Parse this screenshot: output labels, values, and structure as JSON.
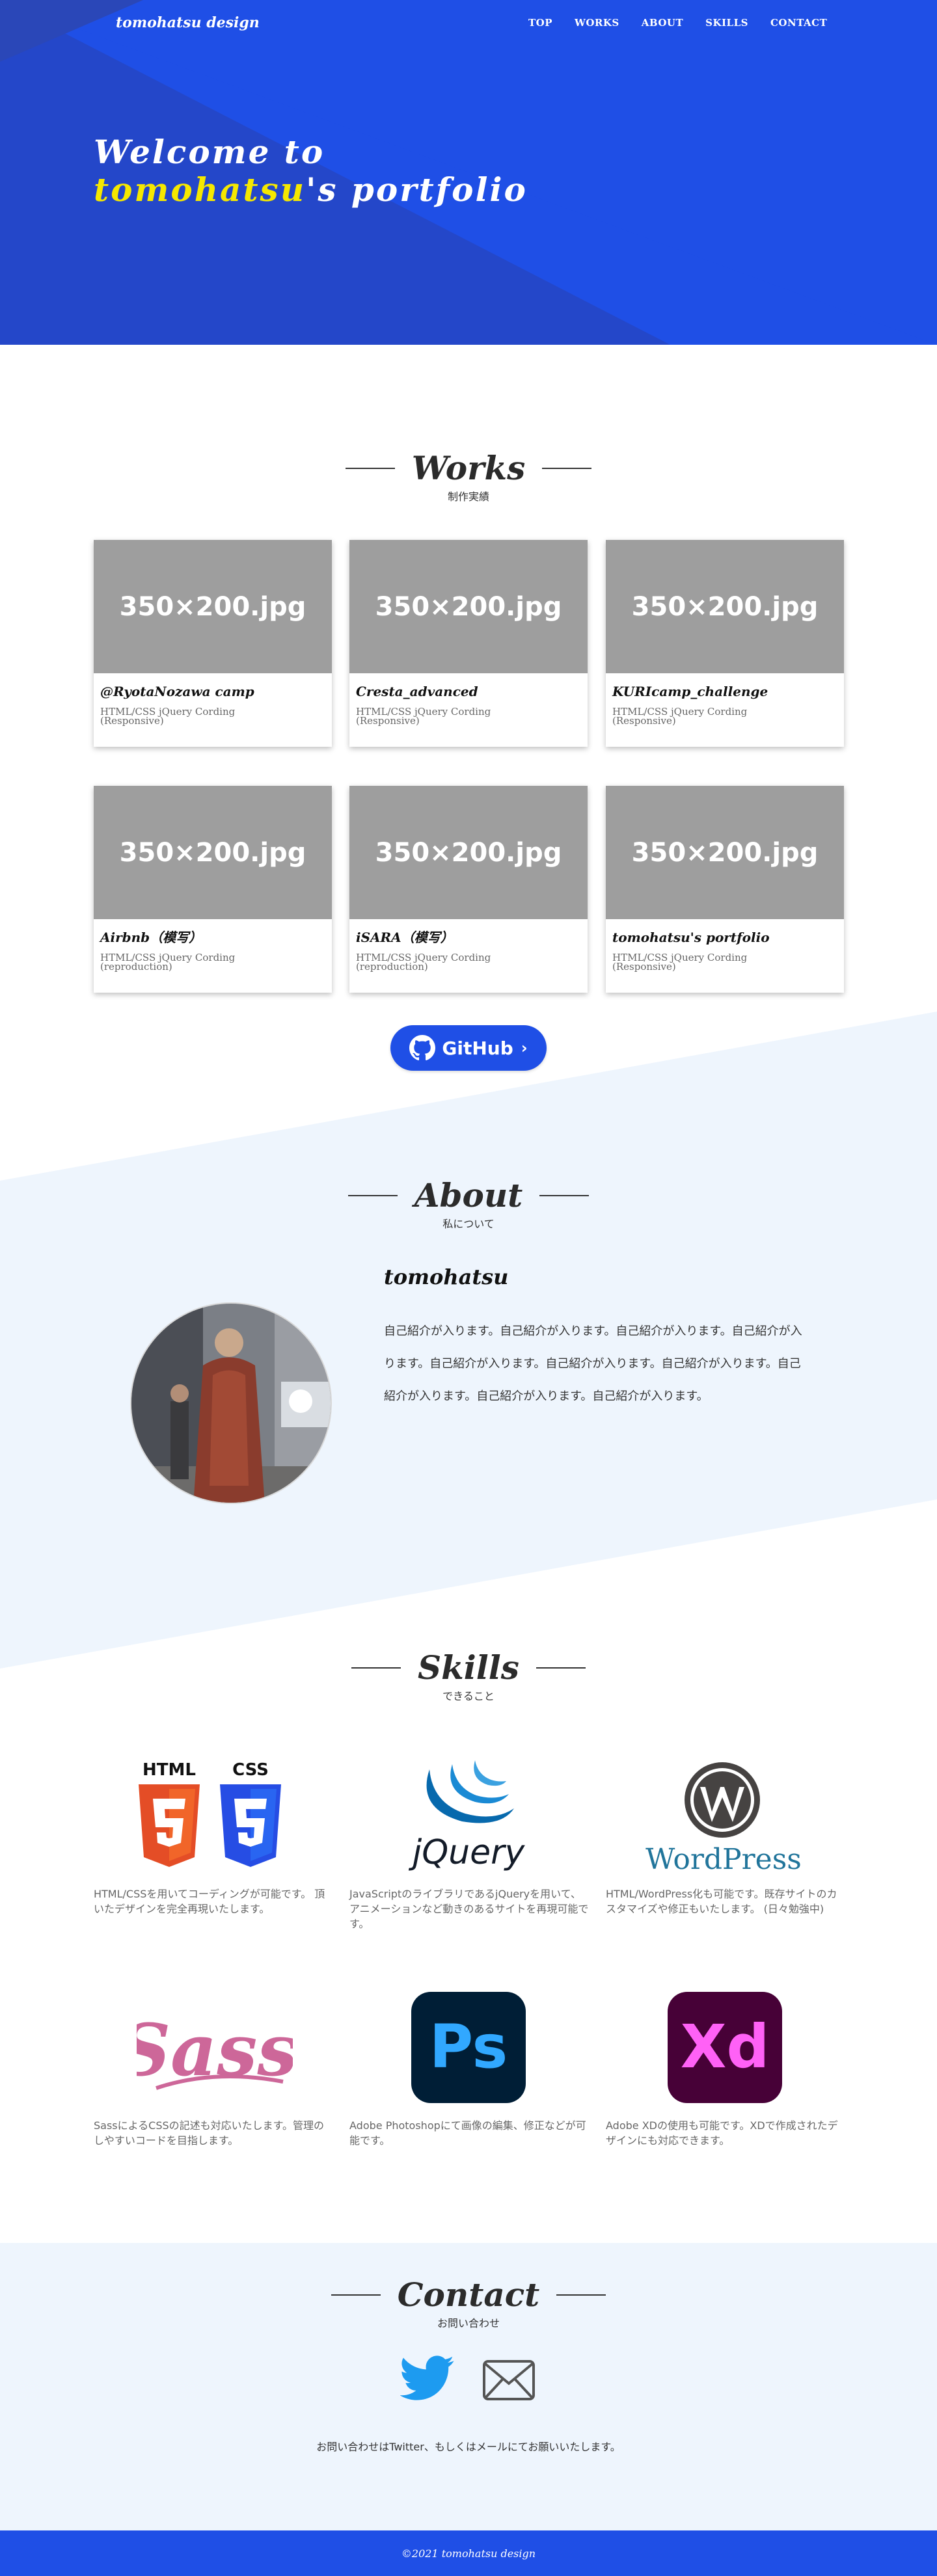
{
  "header": {
    "site_name": "tomohatsu design",
    "nav": [
      "TOP",
      "WORKS",
      "ABOUT",
      "SKILLS",
      "CONTACT"
    ]
  },
  "hero": {
    "line1": "Welcome to",
    "highlight": "tomohatsu",
    "line2_rest": "'s portfolio"
  },
  "works": {
    "title": "Works",
    "subtitle": "制作実績",
    "items": [
      {
        "thumb": "350×200.jpg",
        "title": "@RyotaNozawa camp",
        "desc": "HTML/CSS jQuery Cording (Responsive)"
      },
      {
        "thumb": "350×200.jpg",
        "title": "Cresta_advanced",
        "desc": "HTML/CSS jQuery Cording (Responsive)"
      },
      {
        "thumb": "350×200.jpg",
        "title": "KURIcamp_challenge",
        "desc": "HTML/CSS jQuery Cording (Responsive)"
      },
      {
        "thumb": "350×200.jpg",
        "title": "Airbnb（模写）",
        "desc": "HTML/CSS jQuery Cording (reproduction)"
      },
      {
        "thumb": "350×200.jpg",
        "title": "iSARA（模写）",
        "desc": "HTML/CSS jQuery Cording (reproduction)"
      },
      {
        "thumb": "350×200.jpg",
        "title": "tomohatsu's portfolio",
        "desc": "HTML/CSS jQuery Cording (Responsive)"
      }
    ],
    "github_label": "GitHub"
  },
  "about": {
    "title": "About",
    "subtitle": "私について",
    "name": "tomohatsu",
    "text": "自己紹介が入ります。自己紹介が入ります。自己紹介が入ります。自己紹介が入ります。自己紹介が入ります。自己紹介が入ります。自己紹介が入ります。自己紹介が入ります。自己紹介が入ります。自己紹介が入ります。"
  },
  "skills": {
    "title": "Skills",
    "subtitle": "できること",
    "items": [
      {
        "name": "HTML CSS",
        "logo_text": [
          "HTML",
          "CSS"
        ],
        "desc": "HTML/CSSを用いてコーディングが可能です。 頂いたデザインを完全再現いたします。"
      },
      {
        "name": "jQuery",
        "logo_text": "jQuery",
        "desc": "JavaScriptのライブラリであるjQueryを用いて、アニメーションなど動きのあるサイトを再現可能です。"
      },
      {
        "name": "WordPress",
        "logo_text": "WordPress",
        "desc": "HTML/WordPress化も可能です。既存サイトのカスタマイズや修正もいたします。 (日々勉強中)"
      },
      {
        "name": "Sass",
        "logo_text": "Sass",
        "desc": "SassによるCSSの記述も対応いたします。管理のしやすいコードを目指します。"
      },
      {
        "name": "Photoshop",
        "logo_text": "Ps",
        "desc": "Adobe Photoshopにて画像の編集、修正などが可能です。"
      },
      {
        "name": "Adobe XD",
        "logo_text": "Xd",
        "desc": "Adobe XDの使用も可能です。XDで作成されたデザインにも対応できます。"
      }
    ]
  },
  "contact": {
    "title": "Contact",
    "subtitle": "お問い合わせ",
    "text": "お問い合わせはTwitter、もしくはメールにてお願いいたします。"
  },
  "footer": {
    "copyright": "©2021 tomohatsu design"
  },
  "colors": {
    "primary": "#1f4fe6",
    "hero_dark": "#2447c9",
    "highlight": "#f5e800",
    "thumb_gray": "#9e9e9e",
    "band": "#eef5fd",
    "twitter": "#1d9bf0",
    "html5": "#e44d26",
    "css3": "#264de4",
    "jquery": "#0769ad",
    "wordpress": "#21759b",
    "sass": "#cd6799",
    "photoshop_bg": "#001e36",
    "photoshop_fg": "#31a8ff",
    "xd_bg": "#470137",
    "xd_fg": "#ff61f6"
  }
}
